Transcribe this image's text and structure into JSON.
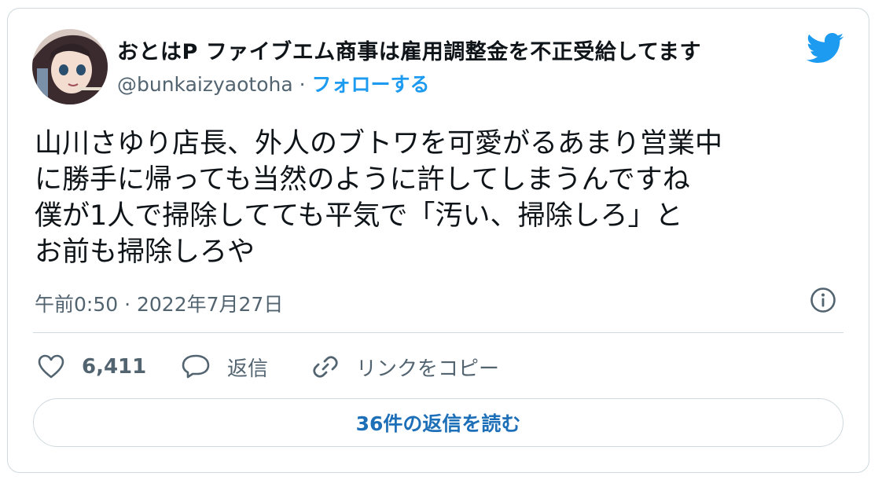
{
  "author": {
    "display_name": "おとはP ファイブエム商事は雇用調整金を不正受給してます",
    "handle": "@bunkaizyaotoha",
    "separator": " · ",
    "follow_label": "フォローする"
  },
  "tweet": {
    "lines": [
      "山川さゆり店長、外人のブトワを可愛がるあまり営業中",
      "に勝手に帰っても当然のように許してしまうんですね",
      "僕が1人で掃除してても平気で「汚い、掃除しろ」と",
      "お前も掃除しろや"
    ],
    "timestamp": "午前0:50 · 2022年7月27日"
  },
  "actions": {
    "likes": "6,411",
    "reply_label": "返信",
    "copy_link_label": "リンクをコピー"
  },
  "read_replies_label": "36件の返信を読む",
  "colors": {
    "accent": "#1d9bf0",
    "twitter_blue": "#1d9bf0",
    "muted": "#536471",
    "border": "#cfd9de"
  },
  "icons": [
    "twitter-bird-icon",
    "info-icon",
    "heart-icon",
    "reply-bubble-icon",
    "link-icon"
  ]
}
